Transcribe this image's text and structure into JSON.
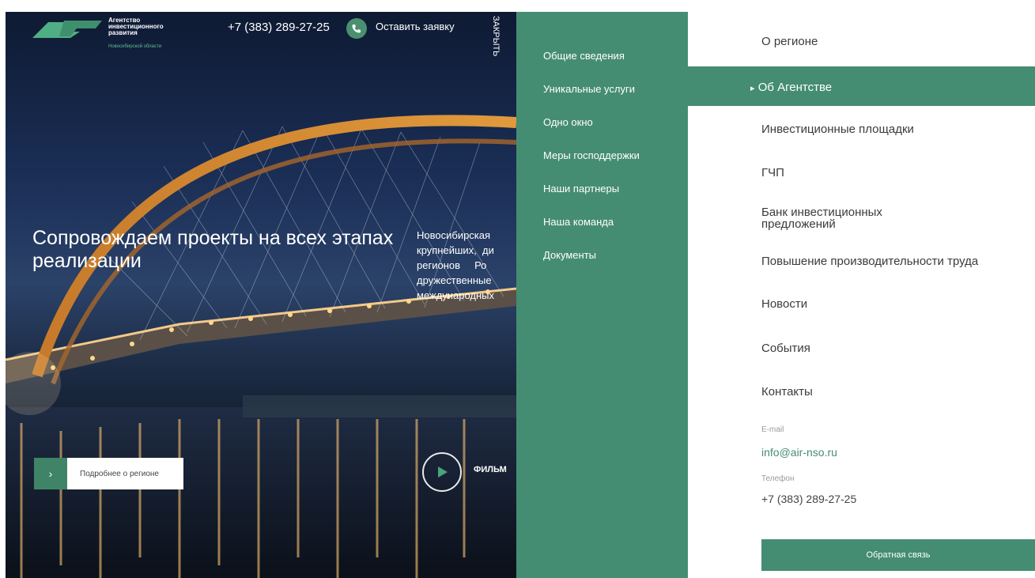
{
  "header": {
    "logo_lines": [
      "Агентство",
      "инвестиционного",
      "развития"
    ],
    "logo_region": "Новосибирской области",
    "phone": "+7 (383) 289-27-25",
    "request_label": "Оставить заявку",
    "close_label": "ЗАКРЫТЬ"
  },
  "hero": {
    "title": "Сопровождаем проекты на всех этапах реализации",
    "description_lines": [
      "Новосибирская",
      "крупнейших,  ди",
      "регионов     Ро",
      "дружественные",
      "международных"
    ],
    "more_label": "Подробнее о регионе",
    "more_arrow": "›",
    "film_label": "ФИЛЬМ"
  },
  "submenu": {
    "items": [
      "Общие сведения",
      "Уникальные услуги",
      "Одно окно",
      "Меры господдержки",
      "Наши партнеры",
      "Наша команда",
      "Документы"
    ]
  },
  "main_menu": {
    "items": [
      "О регионе",
      "Об Агентстве",
      "Инвестиционные площадки",
      "ГЧП",
      "Банк инвестиционных предложений",
      "Повышение производительности труда",
      "Новости",
      "События",
      "Контакты"
    ],
    "active": "Об Агентстве",
    "active_marker": "▸"
  },
  "contacts": {
    "email_label": "E-mail",
    "email": "info@air-nso.ru",
    "phone_label": "Телефон",
    "phone": "+7 (383) 289-27-25",
    "feedback_label": "Обратная связь"
  },
  "colors": {
    "brand_green": "#458d72",
    "white": "#ffffff"
  }
}
